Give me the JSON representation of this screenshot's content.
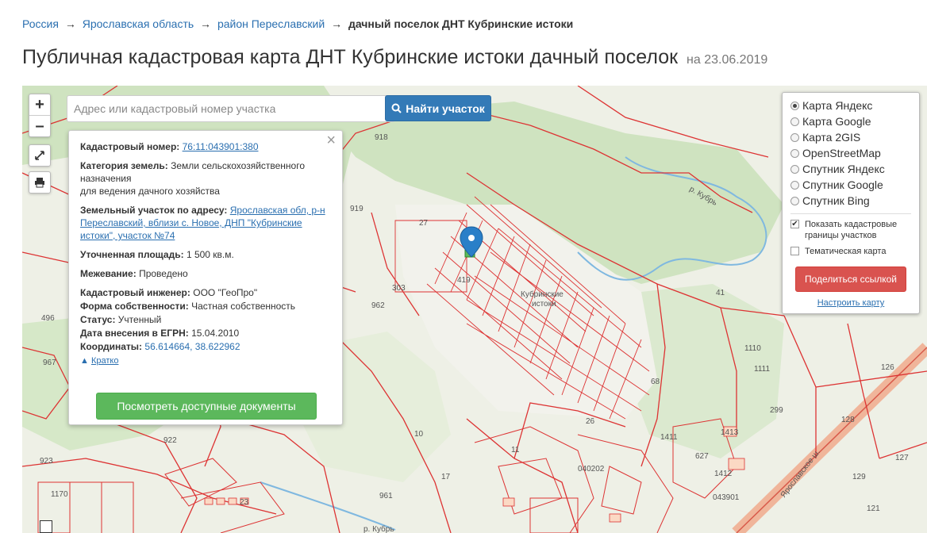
{
  "breadcrumb": {
    "items": [
      "Россия",
      "Ярославская область",
      "район Переславский"
    ],
    "separator": "→",
    "current": "дачный поселок ДНТ Кубринские истоки"
  },
  "page": {
    "title": "Публичная кадастровая карта ДНТ Кубринские истоки дачный поселок",
    "date": "на 23.06.2019"
  },
  "map_controls": {
    "zoom_in": "+",
    "zoom_out": "–"
  },
  "search": {
    "placeholder": "Адрес или кадастровый номер участка",
    "button_label": "Найти участок"
  },
  "info": {
    "cad_number_label": "Кадастровый номер:",
    "cad_number": "76:11:043901:380",
    "category_label": "Категория земель:",
    "category_line1": "Земли сельскохозяйственного",
    "category_line2": "назначения",
    "category_line3": "для ведения дачного хозяйства",
    "address_label": "Земельный участок по адресу:",
    "address_line1": "Ярославская обл, р-н",
    "address_line2": "Переславский, вблизи с. Новое, ДНП \"Кубринские",
    "address_line3": "истоки\", участок №74",
    "area_label": "Уточненная площадь:",
    "area": "1 500 кв.м.",
    "survey_label": "Межевание:",
    "survey": "Проведено",
    "engineer_label": "Кадастровый инженер:",
    "engineer": "ООО \"ГеоПро\"",
    "ownership_label": "Форма собственности:",
    "ownership": "Частная собственность",
    "status_label": "Статус:",
    "status": "Учтенный",
    "egrn_label": "Дата внесения в ЕГРН:",
    "egrn": "15.04.2010",
    "coords_label": "Координаты:",
    "coords": "56.614664, 38.622962",
    "collapse_label": "Кратко",
    "docs_button": "Посмотреть доступные документы"
  },
  "layers": {
    "options": [
      "Карта Яндекс",
      "Карта Google",
      "Карта 2GIS",
      "OpenStreetMap",
      "Спутник Яндекс",
      "Спутник Google",
      "Спутник Bing"
    ],
    "selected": "Карта Яндекс",
    "show_borders": "Показать кадастровые границы участков",
    "show_borders_checked": true,
    "thematic": "Тематическая карта",
    "thematic_checked": false,
    "share_button": "Поделиться ссылкой",
    "configure_link": "Настроить карту"
  },
  "map_labels": {
    "l918": "918",
    "l919": "919",
    "l27": "27",
    "l303": "303",
    "l496": "496",
    "l967": "967",
    "l962": "962",
    "l41": "41",
    "l1110": "1110",
    "l1111": "1111",
    "l68": "68",
    "l26": "26",
    "l10": "10",
    "l11": "11",
    "l17": "17",
    "l922": "922",
    "l923": "923",
    "l23": "23",
    "l961": "961",
    "l1411": "1411",
    "l1413": "1413",
    "l1412": "1412",
    "l627": "627",
    "l299": "299",
    "l126": "126",
    "l128": "128",
    "l127": "127",
    "l129": "129",
    "l121": "121",
    "l040202": "040202",
    "l043901": "043901",
    "l1170": "1170",
    "l419": "419",
    "kubrinskie": "Кубринские",
    "istoki": "истоки",
    "road": "Ярославское ш.",
    "river": "р. Кубрь",
    "river2": "р. Кубрь"
  },
  "colors": {
    "accent_blue": "#337ab7",
    "green_button": "#5cb85c",
    "red_button": "#d9534f",
    "parcel_red": "#d33",
    "map_bg": "#eef0e6",
    "forest": "#cfe3c0"
  }
}
